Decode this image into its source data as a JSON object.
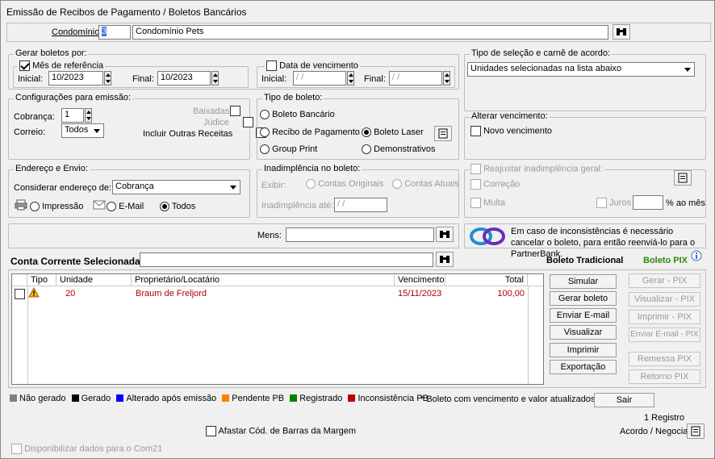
{
  "window": {
    "title": "Emissão de Recibos de Pagamento / Boletos Bancários"
  },
  "condominio": {
    "label": "Condomínio:",
    "code": "3",
    "name": "Condomínio Pets"
  },
  "gerar_boletos": {
    "title": "Gerar boletos por:",
    "mes_ref": {
      "label": "Mês de referência",
      "checked": true,
      "inicial_label": "Inicial:",
      "inicial": "10/2023",
      "final_label": "Final:",
      "final": "10/2023"
    },
    "data_venc": {
      "label": "Data de vencimento",
      "checked": false,
      "inicial_label": "Inicial:",
      "inicial": "/ /",
      "final_label": "Final:",
      "final": "/ /"
    }
  },
  "tipo_selecao": {
    "title": "Tipo de seleção e carnê de acordo:",
    "value": "Unidades selecionadas na lista abaixo"
  },
  "config": {
    "title": "Configurações para emissão:",
    "cobranca_label": "Cobrança:",
    "cobranca": "1",
    "correio_label": "Correio:",
    "correio": "Todos",
    "baixadas": "Baixadas",
    "judice": "Júdice",
    "outras": "Incluir Outras Receitas"
  },
  "tipo_boleto": {
    "title": "Tipo de boleto:",
    "opcoes": [
      "Boleto Bancário",
      "Recibo de Pagamento",
      "Boleto Laser",
      "Group Print",
      "Demonstrativos"
    ],
    "selected": "Boleto Laser"
  },
  "alterar_venc": {
    "title": "Alterar vencimento:",
    "novo": "Novo vencimento"
  },
  "endereco": {
    "title": "Endereço e Envio:",
    "considerar_label": "Considerar endereço de:",
    "considerar": "Cobrança",
    "impressao": "Impressão",
    "email": "E-Mail",
    "todos": "Todos",
    "selected": "Todos"
  },
  "inadimplencia": {
    "title": "Inadimplência no boleto:",
    "exibir_label": "Exibir:",
    "originais": "Contas Originais",
    "atuais": "Contas Atuais",
    "ate_label": "Inadimplência até:",
    "ate": "/ /"
  },
  "reajustar": {
    "title": "Reajustar inadimplência geral:",
    "correcao": "Correção",
    "multa": "Multa",
    "juros": "Juros",
    "ao_mes": "% ao mês"
  },
  "mens": {
    "label": "Mens:",
    "value": ""
  },
  "partner_info": "Em caso de inconsistências é necessário cancelar o boleto, para então reenviá-lo para o PartnerBank.",
  "conta_corrente": {
    "label": "Conta Corrente Selecionada:",
    "value": ""
  },
  "boleto_tradicional": "Boleto Tradicional",
  "boleto_pix": "Boleto PIX",
  "table": {
    "columns": [
      "Tipo",
      "Unidade",
      "Proprietário/Locatário",
      "Vencimento",
      "Total"
    ],
    "rows": [
      {
        "unidade": "20",
        "proprietario": "Braum de Freljord",
        "vencimento": "15/11/2023",
        "total": "100,00"
      }
    ]
  },
  "buttons": {
    "simular": "Simular",
    "gerar": "Gerar boleto",
    "enviar_email": "Enviar E-mail",
    "visualizar": "Visualizar",
    "imprimir": "Imprimir",
    "exportacao": "Exportação"
  },
  "pix_buttons": {
    "gerar": "Gerar - PIX",
    "visualizar": "Visualizar - PIX",
    "imprimir": "Imprimir - PIX",
    "enviar": "Enviar E-mail - PIX",
    "remessa": "Remessa PIX",
    "retorno": "Retorno PIX"
  },
  "status_legend": [
    {
      "label": "Não gerado",
      "color": "#808080"
    },
    {
      "label": "Gerado",
      "color": "#000000"
    },
    {
      "label": "Alterado após emissão",
      "color": "#0000ff"
    },
    {
      "label": "Pendente PB",
      "color": "#ff8000"
    },
    {
      "label": "Registrado",
      "color": "#008000"
    },
    {
      "label": "Inconsistência PB",
      "color": "#c00000"
    }
  ],
  "note": "* Boleto com vencimento e valor atualizados.",
  "sair": "Sair",
  "registros": "1 Registro",
  "afastar": "Afastar Cód. de Barras da Margem",
  "acordo": "Acordo / Negociar",
  "com21": "Disponibilizar dados para o Com21"
}
